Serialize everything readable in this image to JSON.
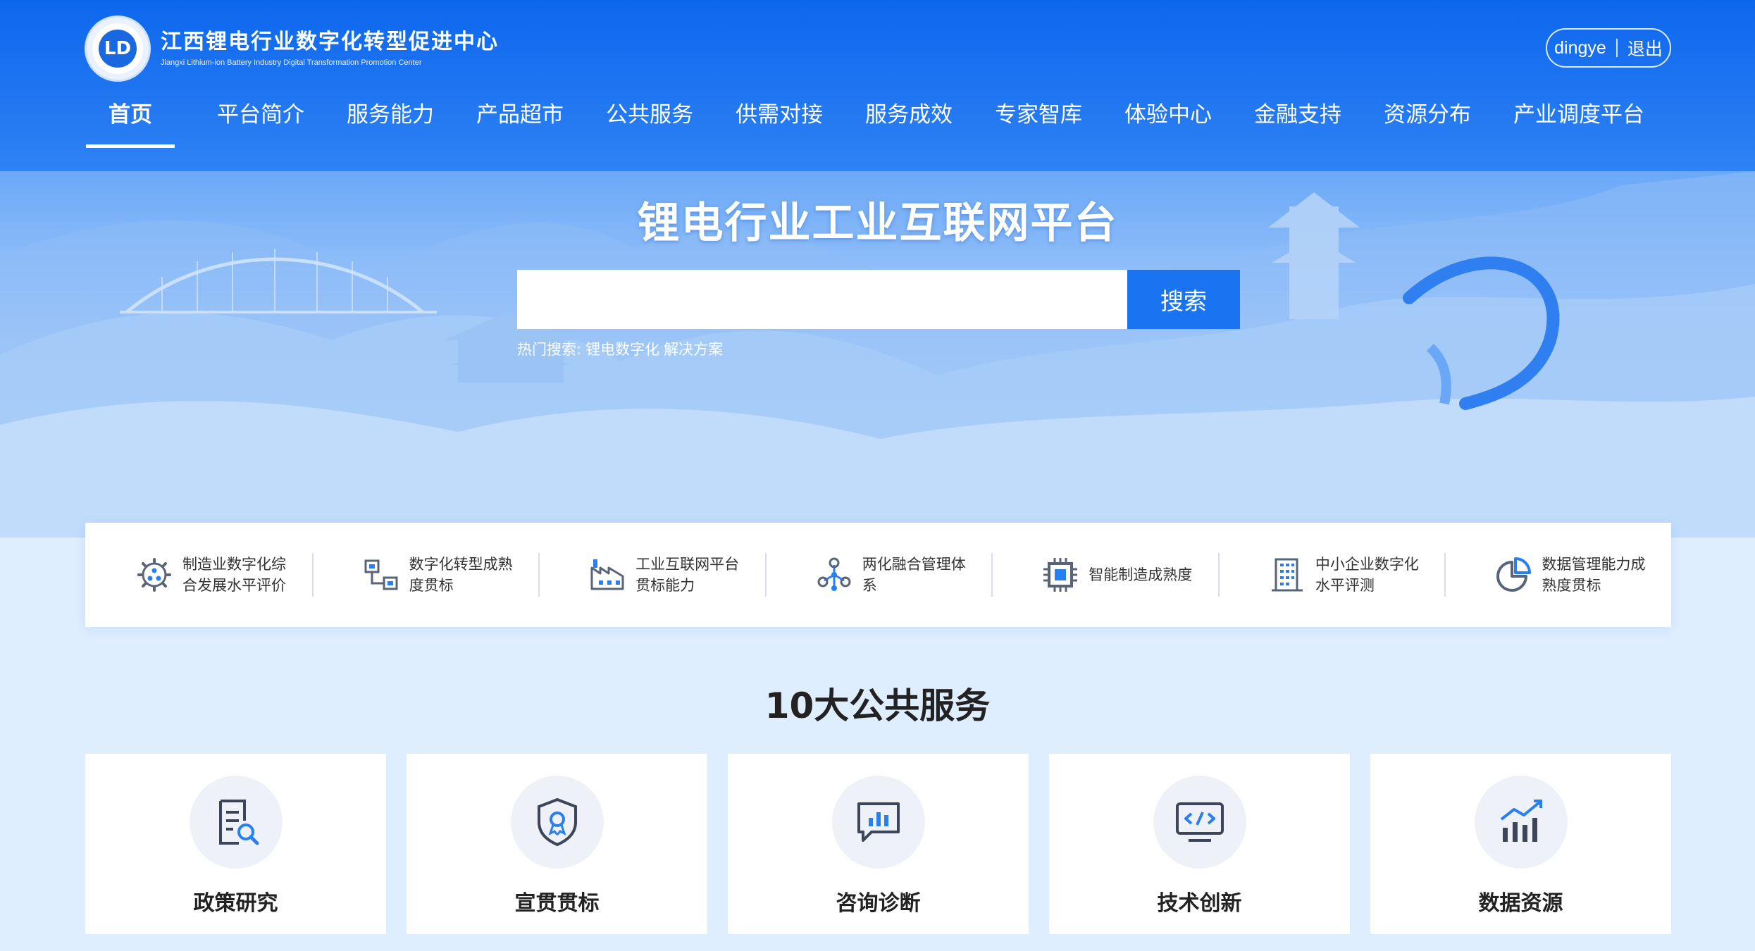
{
  "header": {
    "logo_cn": "江西锂电行业数字化转型促进中心",
    "logo_en": "Jiangxi Lithium-ion Battery Industry Digital Transformation Promotion Center",
    "logo_mark": "LD",
    "user_name": "dingye",
    "logout_label": "退出"
  },
  "nav": {
    "items": [
      {
        "label": "首页"
      },
      {
        "label": "平台简介"
      },
      {
        "label": "服务能力"
      },
      {
        "label": "产品超市"
      },
      {
        "label": "公共服务"
      },
      {
        "label": "供需对接"
      },
      {
        "label": "服务成效"
      },
      {
        "label": "专家智库"
      },
      {
        "label": "体验中心"
      },
      {
        "label": "金融支持"
      },
      {
        "label": "资源分布"
      },
      {
        "label": "产业调度平台"
      }
    ],
    "active_index": 0
  },
  "hero": {
    "title": "锂电行业工业互联网平台",
    "search_placeholder": "",
    "search_button": "搜索",
    "hot_label": "热门搜索:",
    "hot_tags": [
      "锂电数字化",
      "解决方案"
    ]
  },
  "quick": {
    "items": [
      {
        "label": "制造业数字化综合发展水平评价",
        "icon": "gear-network-icon"
      },
      {
        "label": "数字化转型成熟度贯标",
        "icon": "flowchart-icon"
      },
      {
        "label": "工业互联网平台贯标能力",
        "icon": "factory-icon"
      },
      {
        "label": "两化融合管理体系",
        "icon": "molecule-icon"
      },
      {
        "label": "智能制造成熟度",
        "icon": "chip-icon"
      },
      {
        "label": "中小企业数字化水平评测",
        "icon": "building-icon"
      },
      {
        "label": "数据管理能力成熟度贯标",
        "icon": "pie-chart-icon"
      }
    ]
  },
  "services": {
    "title": "10大公共服务",
    "cards": [
      {
        "label": "政策研究",
        "icon": "document-search-icon"
      },
      {
        "label": "宣贯贯标",
        "icon": "shield-ribbon-icon"
      },
      {
        "label": "咨询诊断",
        "icon": "chat-chart-icon"
      },
      {
        "label": "技术创新",
        "icon": "code-monitor-icon"
      },
      {
        "label": "数据资源",
        "icon": "bar-trend-icon"
      }
    ]
  },
  "colors": {
    "primary": "#1a73f0",
    "header_top": "#0d67ee",
    "icon_blue": "#2a7ff0",
    "icon_gray": "#5a6478"
  }
}
